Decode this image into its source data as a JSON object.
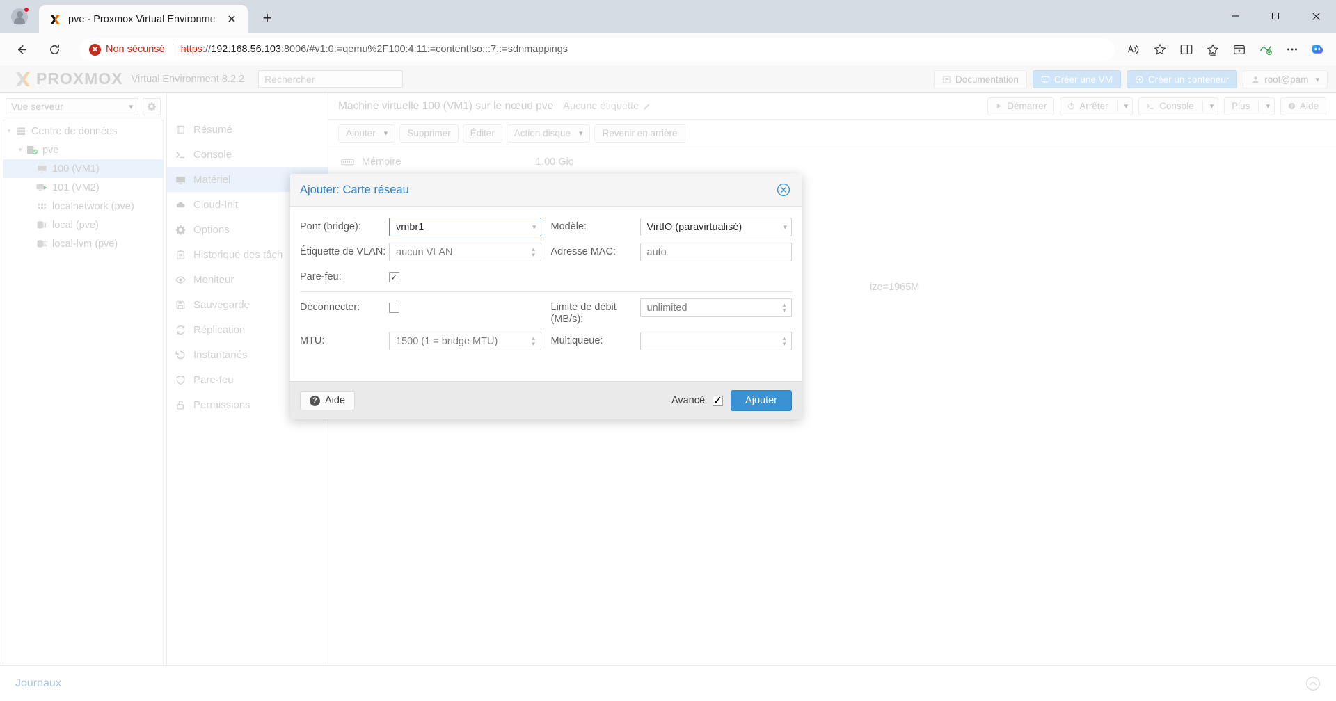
{
  "browser": {
    "tab": {
      "title": "pve - Proxmox Virtual Environme",
      "close_label": "✕",
      "favicon": "proxmox-x-icon"
    },
    "new_tab_label": "+",
    "address_bar": {
      "security_label": "Non sécurisé",
      "security_icon": "error-circle-icon",
      "url_scheme": "https",
      "url_separator": "://",
      "url_host": "192.168.56.103",
      "url_rest": ":8006/#v1:0:=qemu%2F100:4:11:=contentIso:::7::=sdnmappings"
    },
    "window_controls": {
      "minimize": "minimize-icon",
      "maximize": "maximize-icon",
      "close": "close-icon"
    }
  },
  "pve_header": {
    "logo_text": "PROXMOX",
    "env_text": "Virtual Environment 8.2.2",
    "search_placeholder": "Rechercher",
    "buttons": {
      "documentation": "Documentation",
      "create_vm": "Créer une VM",
      "create_ct": "Créer un conteneur",
      "user": "root@pam"
    }
  },
  "sidebar": {
    "view_select": "Vue serveur",
    "gear_icon": "gear-icon",
    "tree": [
      {
        "label": "Centre de données",
        "icon": "datacenter-icon",
        "depth": 0,
        "expanded": true,
        "selected": false
      },
      {
        "label": "pve",
        "icon": "node-icon",
        "depth": 1,
        "expanded": true,
        "selected": false
      },
      {
        "label": "100 (VM1)",
        "icon": "vm-stopped-icon",
        "depth": 2,
        "expanded": false,
        "selected": true
      },
      {
        "label": "101 (VM2)",
        "icon": "vm-running-icon",
        "depth": 2,
        "expanded": false,
        "selected": false
      },
      {
        "label": "localnetwork (pve)",
        "icon": "network-icon",
        "depth": 2,
        "expanded": false,
        "selected": false
      },
      {
        "label": "local (pve)",
        "icon": "storage-icon",
        "depth": 2,
        "expanded": false,
        "selected": false
      },
      {
        "label": "local-lvm (pve)",
        "icon": "storage-icon",
        "depth": 2,
        "expanded": false,
        "selected": false
      }
    ]
  },
  "nav": {
    "items": [
      {
        "label": "Résumé",
        "icon": "book-icon",
        "selected": false
      },
      {
        "label": "Console",
        "icon": "terminal-icon",
        "selected": false
      },
      {
        "label": "Matériel",
        "icon": "monitor-icon",
        "selected": true
      },
      {
        "label": "Cloud-Init",
        "icon": "cloud-icon",
        "selected": false
      },
      {
        "label": "Options",
        "icon": "gear-icon",
        "selected": false
      },
      {
        "label": "Historique des tâch",
        "icon": "clipboard-icon",
        "selected": false
      },
      {
        "label": "Moniteur",
        "icon": "eye-icon",
        "selected": false
      },
      {
        "label": "Sauvegarde",
        "icon": "save-icon",
        "selected": false
      },
      {
        "label": "Réplication",
        "icon": "sync-icon",
        "selected": false
      },
      {
        "label": "Instantanés",
        "icon": "camera-icon",
        "selected": false
      },
      {
        "label": "Pare-feu",
        "icon": "shield-icon",
        "selected": false
      },
      {
        "label": "Permissions",
        "icon": "unlock-icon",
        "selected": false
      }
    ]
  },
  "content": {
    "vm_title": "Machine virtuelle 100 (VM1) sur le nœud pve",
    "tag_label": "Aucune étiquette",
    "tag_icon": "pencil-icon",
    "actions": {
      "start": "Démarrer",
      "stop": "Arrêter",
      "console": "Console",
      "more": "Plus",
      "help": "Aide"
    },
    "toolbar": {
      "add": "Ajouter",
      "remove": "Supprimer",
      "edit": "Éditer",
      "disk_action": "Action disque",
      "revert": "Revenir en arrière"
    },
    "hardware_rows": [
      {
        "icon": "memory-icon",
        "name": "Mémoire",
        "value": "1.00 Gio"
      },
      {
        "icon": "cpu-icon",
        "name": "",
        "value": "ize=1965M"
      }
    ]
  },
  "journaux": {
    "label": "Journaux",
    "chevron_icon": "chevron-up-icon"
  },
  "modal": {
    "title": "Ajouter: Carte réseau",
    "close_icon": "close-circle-icon",
    "fields": {
      "bridge": {
        "label": "Pont (bridge):",
        "value": "vmbr1",
        "type": "select",
        "focused": true
      },
      "vlan_tag": {
        "label": "Étiquette de VLAN:",
        "value": "aucun VLAN",
        "type": "spinner"
      },
      "firewall": {
        "label": "Pare-feu:",
        "checked": true,
        "type": "checkbox"
      },
      "model": {
        "label": "Modèle:",
        "value": "VirtIO (paravirtualisé)",
        "type": "select"
      },
      "mac_address": {
        "label": "Adresse MAC:",
        "value": "auto",
        "type": "text"
      },
      "disconnect": {
        "label": "Déconnecter:",
        "checked": false,
        "type": "checkbox"
      },
      "mtu": {
        "label": "MTU:",
        "value": "1500 (1 = bridge MTU)",
        "type": "spinner"
      },
      "rate_limit": {
        "label": "Limite de débit (MB/s):",
        "value": "unlimited",
        "type": "spinner"
      },
      "multiqueue": {
        "label": "Multiqueue:",
        "value": "",
        "type": "spinner"
      }
    },
    "footer": {
      "help_label": "Aide",
      "help_icon": "question-icon",
      "advanced_label": "Avancé",
      "advanced_checked": true,
      "submit_label": "Ajouter"
    }
  }
}
